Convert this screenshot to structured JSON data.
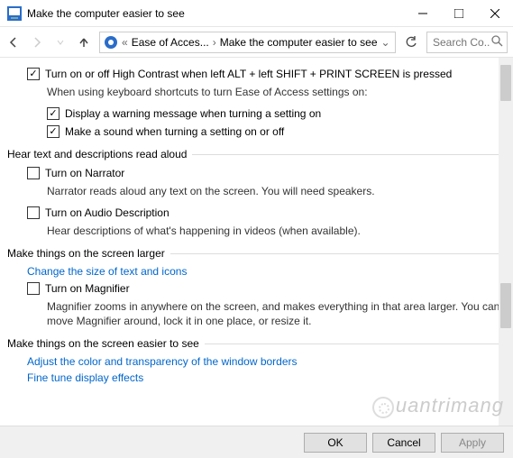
{
  "window": {
    "title": "Make the computer easier to see"
  },
  "nav": {
    "crumb1": "Ease of Acces...",
    "crumb2": "Make the computer easier to see",
    "search_placeholder": "Search Co..."
  },
  "opt": {
    "high_contrast": "Turn on or off High Contrast when left ALT + left SHIFT + PRINT SCREEN is pressed",
    "shortcuts_desc": "When using keyboard shortcuts to turn Ease of Access settings on:",
    "warn": "Display a warning message when turning a setting on",
    "sound": "Make a sound when turning a setting on or off"
  },
  "narr": {
    "header": "Hear text and descriptions read aloud",
    "narrator": "Turn on Narrator",
    "narrator_desc": "Narrator reads aloud any text on the screen. You will need speakers.",
    "audio": "Turn on Audio Description",
    "audio_desc": "Hear descriptions of what's happening in videos (when available)."
  },
  "larger": {
    "header": "Make things on the screen larger",
    "link": "Change the size of text and icons",
    "magnifier": "Turn on Magnifier",
    "magnifier_desc": "Magnifier zooms in anywhere on the screen, and makes everything in that area larger. You can move Magnifier around, lock it in one place, or resize it."
  },
  "easier": {
    "header": "Make things on the screen easier to see",
    "link1": "Adjust the color and transparency of the window borders",
    "link2": "Fine tune display effects"
  },
  "buttons": {
    "ok": "OK",
    "cancel": "Cancel",
    "apply": "Apply"
  },
  "watermark": "uantrimang"
}
